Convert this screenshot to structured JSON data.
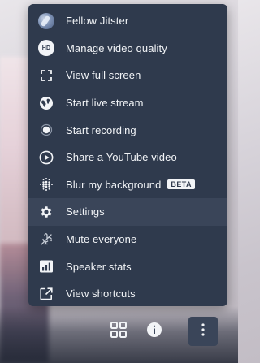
{
  "menu": {
    "items": [
      {
        "label": "Fellow Jitster",
        "icon": "avatar-icon"
      },
      {
        "label": "Manage video quality",
        "icon": "hd-icon",
        "icon_text": "HD"
      },
      {
        "label": "View full screen",
        "icon": "fullscreen-icon"
      },
      {
        "label": "Start live stream",
        "icon": "globe-icon"
      },
      {
        "label": "Start recording",
        "icon": "record-icon"
      },
      {
        "label": "Share a YouTube video",
        "icon": "play-circle-icon"
      },
      {
        "label": "Blur my background",
        "icon": "blur-dots-icon",
        "badge": "BETA"
      },
      {
        "label": "Settings",
        "icon": "gear-icon",
        "active": true
      },
      {
        "label": "Mute everyone",
        "icon": "mute-everyone-icon"
      },
      {
        "label": "Speaker stats",
        "icon": "speaker-stats-icon"
      },
      {
        "label": "View shortcuts",
        "icon": "external-link-icon"
      }
    ]
  },
  "toolbar": {
    "buttons": [
      {
        "name": "tile-view-button",
        "icon": "grid-icon"
      },
      {
        "name": "info-button",
        "icon": "info-icon"
      },
      {
        "name": "more-options-button",
        "icon": "vertical-dots-icon",
        "selected": true
      }
    ]
  },
  "colors": {
    "menu_bg": "#2f3a4d",
    "menu_active_bg": "#3a4559",
    "text": "#f2f4f7"
  }
}
